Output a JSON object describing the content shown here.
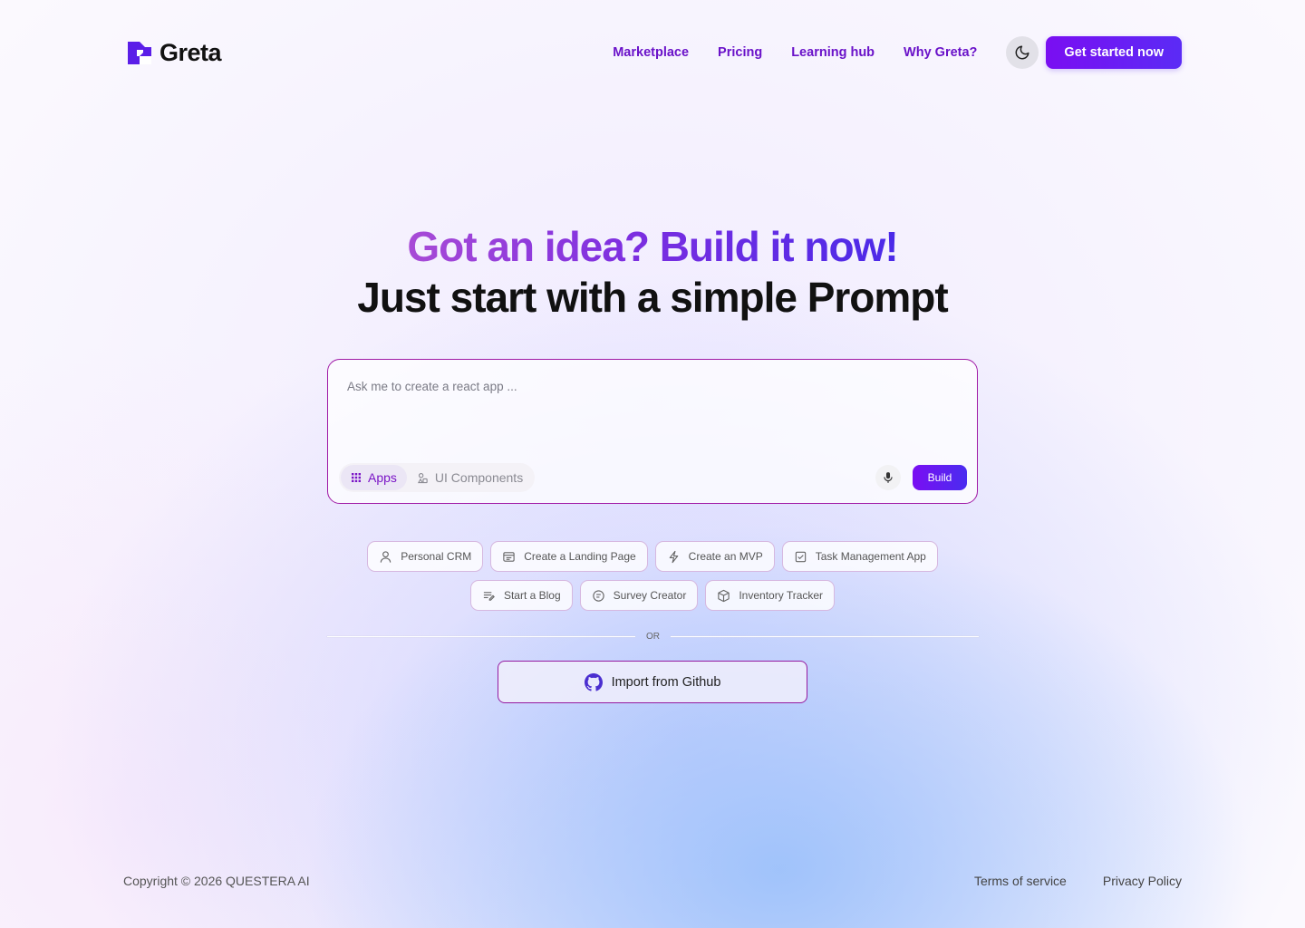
{
  "brand": {
    "name": "Greta",
    "accent": "#7a0ef2",
    "nav_color": "#6a12c9"
  },
  "nav": {
    "items": [
      "Marketplace",
      "Pricing",
      "Learning hub",
      "Why Greta?"
    ],
    "theme_icon": "moon-icon",
    "cta": "Get started now"
  },
  "hero": {
    "line1": "Got an idea? Build it now!",
    "line2": "Just start with a simple Prompt"
  },
  "prompt": {
    "placeholder": "Ask me to create a react app ...",
    "modes": [
      {
        "label": "Apps",
        "icon": "grid-icon",
        "active": true
      },
      {
        "label": "UI Components",
        "icon": "shapes-icon",
        "active": false
      }
    ],
    "mic_icon": "microphone-icon",
    "build": "Build"
  },
  "suggestions": {
    "row1": [
      {
        "label": "Personal CRM",
        "icon": "user-icon"
      },
      {
        "label": "Create a Landing Page",
        "icon": "browser-icon"
      },
      {
        "label": "Create an MVP",
        "icon": "zap-icon"
      },
      {
        "label": "Task Management App",
        "icon": "checklist-icon"
      }
    ],
    "row2": [
      {
        "label": "Start a Blog",
        "icon": "edit-lines-icon"
      },
      {
        "label": "Survey Creator",
        "icon": "list-circle-icon"
      },
      {
        "label": "Inventory Tracker",
        "icon": "box-icon"
      }
    ]
  },
  "divider": "OR",
  "import": {
    "label": "Import from Github",
    "icon": "github-icon"
  },
  "footer": {
    "copyright": "Copyright © 2026 QUESTERA AI",
    "links": [
      "Terms of service",
      "Privacy Policy"
    ]
  }
}
